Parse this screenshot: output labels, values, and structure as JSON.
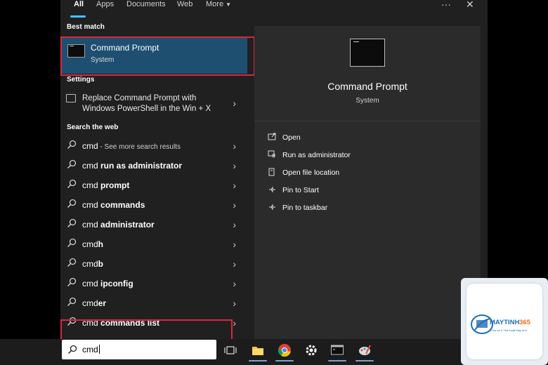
{
  "tabs": [
    "All",
    "Apps",
    "Documents",
    "Web",
    "More"
  ],
  "window_controls": {
    "more": "···",
    "close": "✕"
  },
  "sections": {
    "best_match": "Best match",
    "settings": "Settings",
    "search_web": "Search the web"
  },
  "best_match": {
    "title": "Command Prompt",
    "subtitle": "System"
  },
  "settings_item": {
    "text": "Replace Command Prompt with Windows PowerShell in the Win + X"
  },
  "web_results": [
    {
      "pre": "cmd",
      "bold": "",
      "muted": " - See more search results"
    },
    {
      "pre": "cmd ",
      "bold": "run as administrator",
      "muted": ""
    },
    {
      "pre": "cmd ",
      "bold": "prompt",
      "muted": ""
    },
    {
      "pre": "cmd ",
      "bold": "commands",
      "muted": ""
    },
    {
      "pre": "cmd ",
      "bold": "administrator",
      "muted": ""
    },
    {
      "pre": "cmd",
      "bold": "h",
      "muted": ""
    },
    {
      "pre": "cmd",
      "bold": "b",
      "muted": ""
    },
    {
      "pre": "cmd ",
      "bold": "ipconfig",
      "muted": ""
    },
    {
      "pre": "cmd",
      "bold": "er",
      "muted": ""
    },
    {
      "pre": "cmd ",
      "bold": "commands list",
      "muted": ""
    }
  ],
  "detail": {
    "title": "Command Prompt",
    "subtitle": "System",
    "actions": [
      {
        "label": "Open",
        "icon": "open-icon"
      },
      {
        "label": "Run as administrator",
        "icon": "shield-icon"
      },
      {
        "label": "Open file location",
        "icon": "file-location-icon"
      },
      {
        "label": "Pin to Start",
        "icon": "pin-icon"
      },
      {
        "label": "Pin to taskbar",
        "icon": "pin-icon"
      }
    ]
  },
  "search": {
    "value": "cmd"
  },
  "taskbar_icons": [
    "task-view-icon",
    "file-explorer-icon",
    "chrome-icon",
    "settings-icon",
    "terminal-icon",
    "paint-icon"
  ],
  "logo": {
    "text": "MAYTINH365",
    "tagline": "Chia sẻ & Thủ thuật Máy tính"
  },
  "colors": {
    "accent": "#4cc2ff",
    "selection": "#1e4f71",
    "highlight_box": "#d9283c"
  }
}
